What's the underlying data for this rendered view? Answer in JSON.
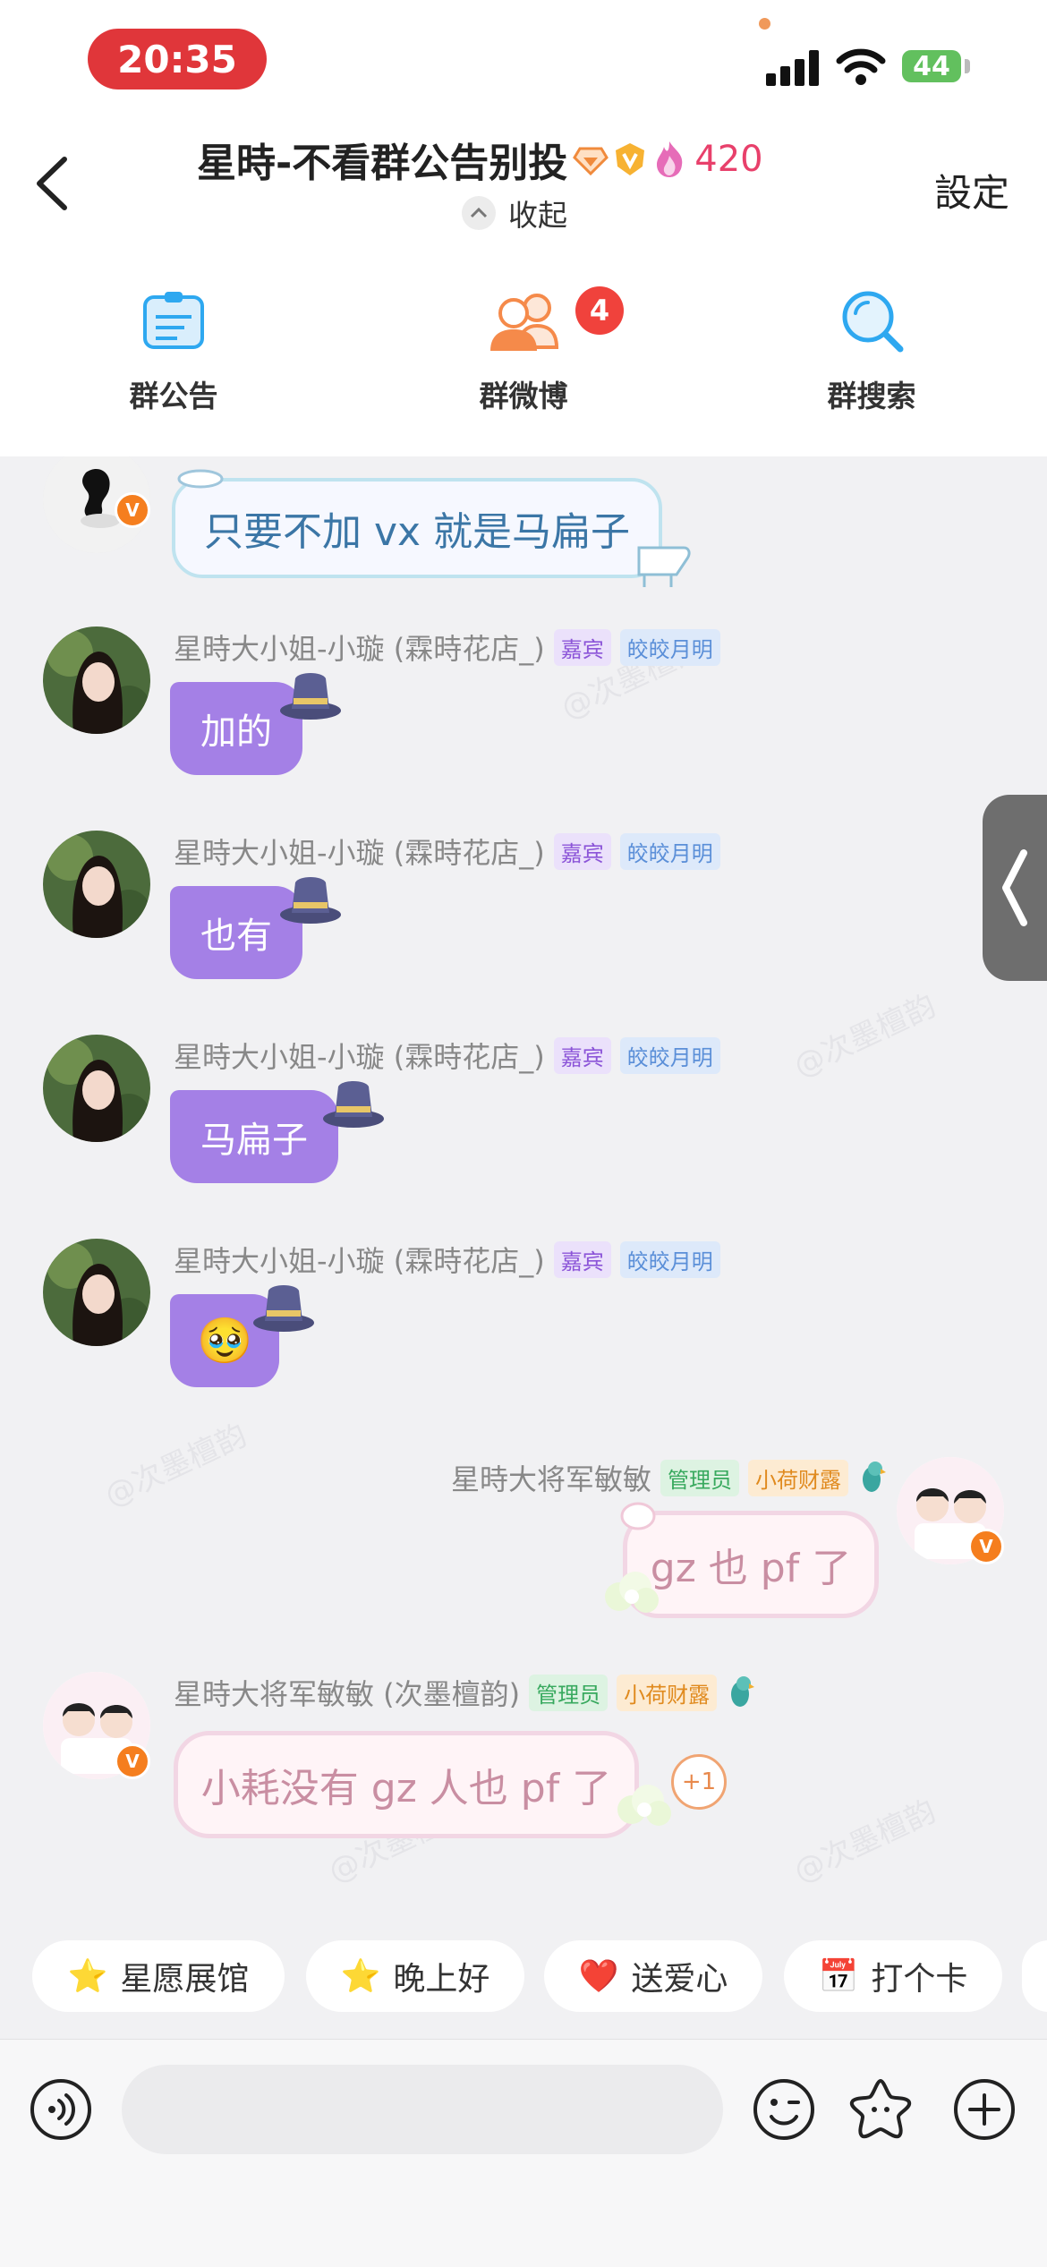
{
  "status_bar": {
    "time": "20:35",
    "battery": "44"
  },
  "header": {
    "title": "星時-不看群公告别投",
    "hot_count": "420",
    "collapse_label": "收起",
    "settings_label": "設定"
  },
  "tabs": [
    {
      "label": "群公告"
    },
    {
      "label": "群微博",
      "badge": "4"
    },
    {
      "label": "群搜索"
    }
  ],
  "messages": [
    {
      "text": "只要不加 vx 就是马扁子"
    },
    {
      "sender": "星時大小姐-小璇 (霖時花店_)",
      "tag1": "嘉宾",
      "tag2": "皎皎月明",
      "text": "加的"
    },
    {
      "sender": "星時大小姐-小璇 (霖時花店_)",
      "tag1": "嘉宾",
      "tag2": "皎皎月明",
      "text": "也有"
    },
    {
      "sender": "星時大小姐-小璇 (霖時花店_)",
      "tag1": "嘉宾",
      "tag2": "皎皎月明",
      "text": "马扁子"
    },
    {
      "sender": "星時大小姐-小璇 (霖時花店_)",
      "tag1": "嘉宾",
      "tag2": "皎皎月明",
      "emoji": "🥹"
    },
    {
      "sender": "星時大将军敏敏",
      "tag1": "管理员",
      "tag2": "小荷财露",
      "text": "gz 也 pf 了"
    },
    {
      "sender": "星時大将军敏敏 (次墨檀韵)",
      "tag1": "管理员",
      "tag2": "小荷财露",
      "text": "小耗没有 gz 人也 pf 了",
      "reaction": "+1"
    }
  ],
  "watermark": "@次墨檀韵",
  "quick_actions": [
    {
      "label": "星愿展馆",
      "icon": "⭐"
    },
    {
      "label": "晚上好",
      "icon": "⭐"
    },
    {
      "label": "送爱心",
      "icon": "❤️"
    },
    {
      "label": "打个卡",
      "icon": "📅"
    }
  ],
  "input": {
    "placeholder": ""
  },
  "colors": {
    "accent": "#e8406b",
    "bubble_purple": "#a480e6",
    "badge_red": "#f0423c",
    "brand_blue": "#2ea8f0"
  }
}
